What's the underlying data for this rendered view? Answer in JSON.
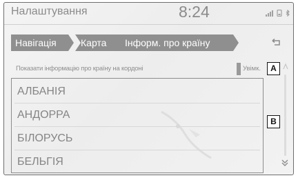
{
  "header": {
    "title": "Налаштування",
    "time": "8:24",
    "icons": [
      "signal-icon",
      "phone-icon",
      "bluetooth-icon"
    ]
  },
  "breadcrumb": {
    "items": [
      {
        "label": "Навігація"
      },
      {
        "label": "Карта"
      },
      {
        "label": "Інформ. про країну"
      }
    ]
  },
  "back_icon": "return-arrow-icon",
  "setting": {
    "label": "Показати інформацію про країну на кордоні",
    "state": "Увімк."
  },
  "countries": {
    "items": [
      "АЛБАНІЯ",
      "АНДОРРА",
      "БІЛОРУСЬ",
      "БЕЛЬГІЯ"
    ]
  },
  "callouts": {
    "a": "A",
    "b": "B"
  },
  "scroll_icons": {
    "down": "double-chevron-down-icon"
  },
  "colors": {
    "background": "#efefef",
    "breadcrumb": "#8f8f8f",
    "text": "#858585"
  }
}
